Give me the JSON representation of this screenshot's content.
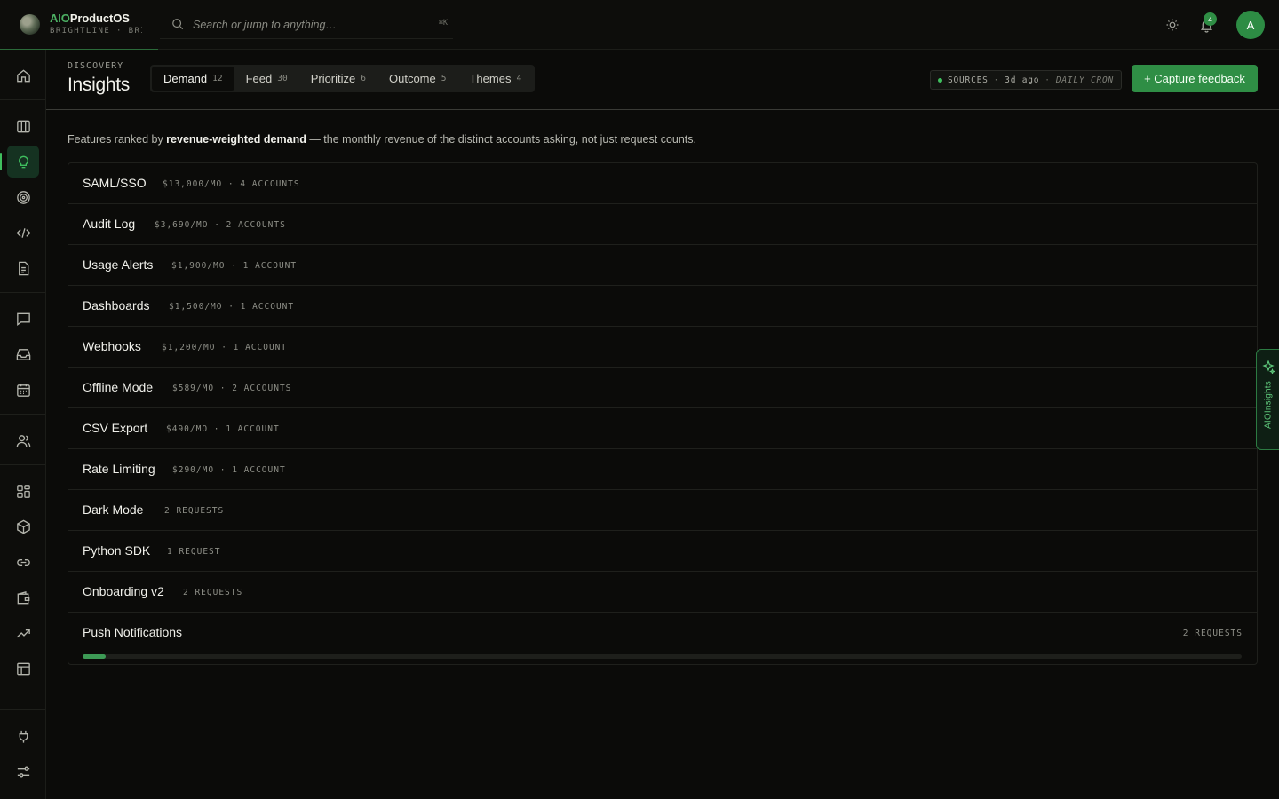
{
  "brand": {
    "name_prefix": "AIO",
    "name_suffix": "ProductOS",
    "subtitle": "BRIGHTLINE · BRI…"
  },
  "search": {
    "placeholder": "Search or jump to anything…",
    "shortcut": "⌘K"
  },
  "header": {
    "notification_count": "4",
    "avatar_initial": "A"
  },
  "page": {
    "eyebrow": "DISCOVERY",
    "title": "Insights"
  },
  "tabs": [
    {
      "label": "Demand",
      "count": "12",
      "active": true
    },
    {
      "label": "Feed",
      "count": "30"
    },
    {
      "label": "Prioritize",
      "count": "6"
    },
    {
      "label": "Outcome",
      "count": "5"
    },
    {
      "label": "Themes",
      "count": "4"
    }
  ],
  "sources": {
    "label": "SOURCES",
    "age": "3d ago",
    "schedule": "DAILY CRON"
  },
  "capture_button": "+ Capture feedback",
  "description": {
    "prefix": "Features ranked by ",
    "emphasis": "revenue-weighted demand",
    "suffix": " — the monthly revenue of the distinct accounts asking, not just request counts."
  },
  "features": [
    {
      "name": "SAML/SSO",
      "meta": "$13,000/MO · 4 ACCOUNTS"
    },
    {
      "name": "Audit Log",
      "meta": "$3,690/MO · 2 ACCOUNTS"
    },
    {
      "name": "Usage Alerts",
      "meta": "$1,900/MO · 1 ACCOUNT"
    },
    {
      "name": "Dashboards",
      "meta": "$1,500/MO · 1 ACCOUNT"
    },
    {
      "name": "Webhooks",
      "meta": "$1,200/MO · 1 ACCOUNT"
    },
    {
      "name": "Offline Mode",
      "meta": "$589/MO · 2 ACCOUNTS"
    },
    {
      "name": "CSV Export",
      "meta": "$490/MO · 1 ACCOUNT"
    },
    {
      "name": "Rate Limiting",
      "meta": "$290/MO · 1 ACCOUNT"
    },
    {
      "name": "Dark Mode",
      "meta": "2 REQUESTS"
    },
    {
      "name": "Python SDK",
      "meta": "1 REQUEST"
    },
    {
      "name": "Onboarding v2",
      "meta": "2 REQUESTS"
    },
    {
      "name": "Push Notifications",
      "meta": "2 REQUESTS",
      "progress": 0.02
    }
  ],
  "side_panel": {
    "label": "AIOInsights"
  },
  "colors": {
    "accent": "#2f8e45",
    "accent_bright": "#3fbf5e",
    "background": "#0b0b09"
  },
  "sidebar_icons": [
    "home-icon",
    "board-icon",
    "lightbulb-icon",
    "target-icon",
    "code-icon",
    "document-icon",
    "chat-icon",
    "inbox-icon",
    "calendar-icon",
    "users-icon",
    "grid-icon",
    "box-icon",
    "link-icon",
    "wallet-icon",
    "trending-icon",
    "table-icon",
    "plug-icon",
    "sliders-icon"
  ]
}
